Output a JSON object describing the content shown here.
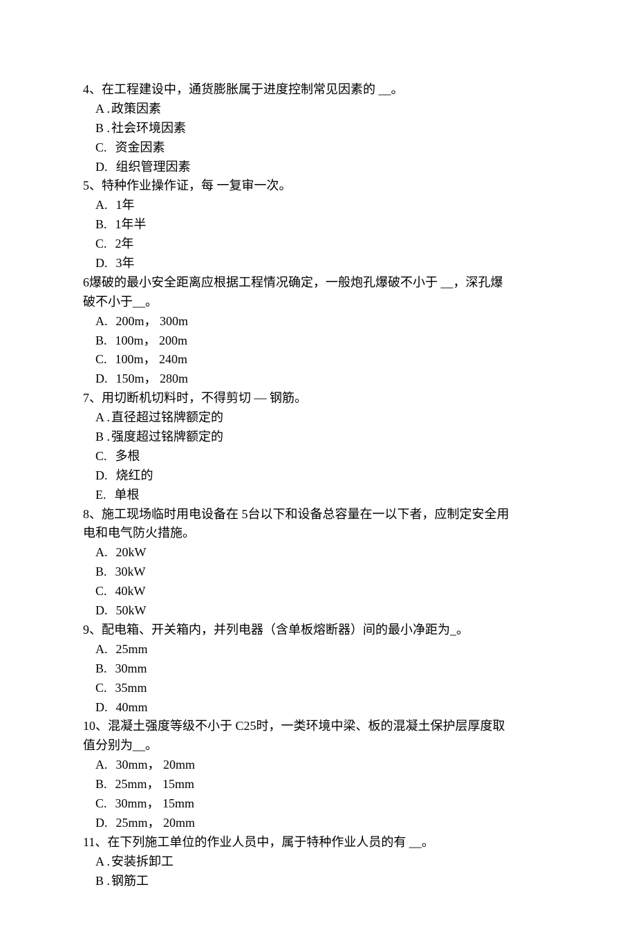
{
  "questions": [
    {
      "number": "4、",
      "stem": "在工程建设中，通货膨胀属于进度控制常见因素的   __。",
      "stem_cont": "",
      "options": [
        {
          "label": "A .",
          "text": "政策因素",
          "gap": "tight"
        },
        {
          "label": "B .",
          "text": "社会环境因素",
          "gap": "tight"
        },
        {
          "label": "C.",
          "text": "资金因素",
          "gap": "wide"
        },
        {
          "label": "D.",
          "text": "组织管理因素",
          "gap": "wide"
        }
      ]
    },
    {
      "number": "5、",
      "stem": "特种作业操作证，每 一复审一次。",
      "stem_cont": "",
      "options": [
        {
          "label": "A.",
          "text": "1年",
          "gap": "wide"
        },
        {
          "label": "B.",
          "text": "1年半",
          "gap": "wide"
        },
        {
          "label": "C.",
          "text": "2年",
          "gap": "wide"
        },
        {
          "label": "D.",
          "text": "3年",
          "gap": "wide"
        }
      ]
    },
    {
      "number": "6",
      "stem": "爆破的最小安全距离应根据工程情况确定，一般炮孔爆破不小于       __，深孔爆",
      "stem_cont": "破不小于__。",
      "options": [
        {
          "label": "A.",
          "text": "200m， 300m",
          "gap": "wide"
        },
        {
          "label": "B.",
          "text": "100m， 200m",
          "gap": "wide"
        },
        {
          "label": "C.",
          "text": "100m， 240m",
          "gap": "wide"
        },
        {
          "label": "D.",
          "text": "150m， 280m",
          "gap": "wide"
        }
      ]
    },
    {
      "number": "7、",
      "stem": "用切断机切料时，不得剪切 — 钢筋。",
      "stem_cont": "",
      "options": [
        {
          "label": "A .",
          "text": "直径超过铭牌额定的",
          "gap": "tight"
        },
        {
          "label": "B .",
          "text": "强度超过铭牌额定的",
          "gap": "tight"
        },
        {
          "label": "C.",
          "text": "多根",
          "gap": "wide"
        },
        {
          "label": "D.",
          "text": "烧红的",
          "gap": "wide"
        },
        {
          "label": "E.",
          "text": "单根",
          "gap": "wide"
        }
      ]
    },
    {
      "number": "8、",
      "stem": "施工现场临时用电设备在 5台以下和设备总容量在一以下者，应制定安全用",
      "stem_cont": "电和电气防火措施。",
      "options": [
        {
          "label": "A.",
          "text": "20kW",
          "gap": "wide"
        },
        {
          "label": "B.",
          "text": "30kW",
          "gap": "wide"
        },
        {
          "label": "C.",
          "text": "40kW",
          "gap": "wide"
        },
        {
          "label": "D.",
          "text": "50kW",
          "gap": "wide"
        }
      ]
    },
    {
      "number": "9、",
      "stem": "配电箱、开关箱内，并列电器（含单板熔断器）间的最小净距为_。",
      "stem_cont": "",
      "options": [
        {
          "label": "A.",
          "text": "25mm",
          "gap": "wide"
        },
        {
          "label": "B.",
          "text": "30mm",
          "gap": "wide"
        },
        {
          "label": "C.",
          "text": "35mm",
          "gap": "wide"
        },
        {
          "label": "D.",
          "text": "40mm",
          "gap": "wide"
        }
      ]
    },
    {
      "number": "10、",
      "stem": "混凝土强度等级不小于 C25时，一类环境中梁、板的混凝土保护层厚度取",
      "stem_cont": "值分别为__。",
      "options": [
        {
          "label": "A.",
          "text": "30mm， 20mm",
          "gap": "wide"
        },
        {
          "label": "B.",
          "text": "25mm， 15mm",
          "gap": "wide"
        },
        {
          "label": "C.",
          "text": "30mm， 15mm",
          "gap": "wide"
        },
        {
          "label": "D.",
          "text": "25mm， 20mm",
          "gap": "wide"
        }
      ]
    },
    {
      "number": "11、",
      "stem": "在下列施工单位的作业人员中，属于特种作业人员的有  __。",
      "stem_cont": "",
      "options": [
        {
          "label": "A .",
          "text": "安装拆卸工",
          "gap": "tight"
        },
        {
          "label": "B .",
          "text": "钢筋工",
          "gap": "tight"
        }
      ]
    }
  ]
}
